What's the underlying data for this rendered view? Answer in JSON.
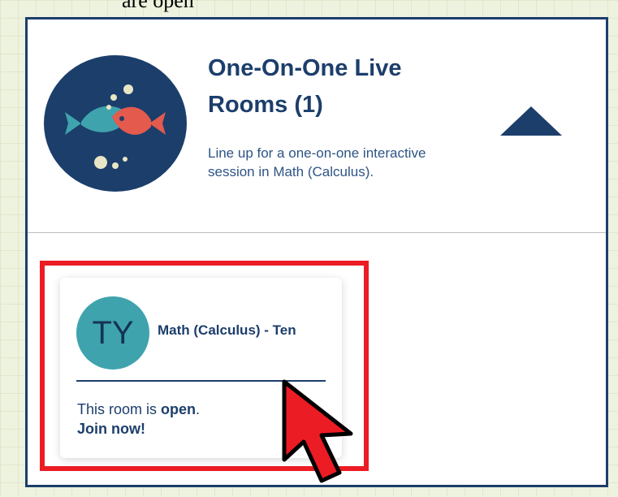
{
  "top_text": "are open",
  "section": {
    "title": "One-On-One Live Rooms (1)",
    "description": "Line up for a one-on-one interactive session in Math (Calculus)."
  },
  "room": {
    "avatar_initials": "TY",
    "name": "Math (Calculus) - Ten",
    "status_prefix": "This room is ",
    "status_value": "open",
    "status_suffix": ".",
    "join_label": "Join now!"
  },
  "colors": {
    "navy": "#1c3e6b",
    "teal": "#3fa3ae",
    "coral": "#e45a4d",
    "highlight_red": "#ec1c24"
  },
  "icons": {
    "logo": "fish-logo-icon",
    "collapse": "triangle-up-icon",
    "cursor": "mouse-pointer-icon"
  }
}
